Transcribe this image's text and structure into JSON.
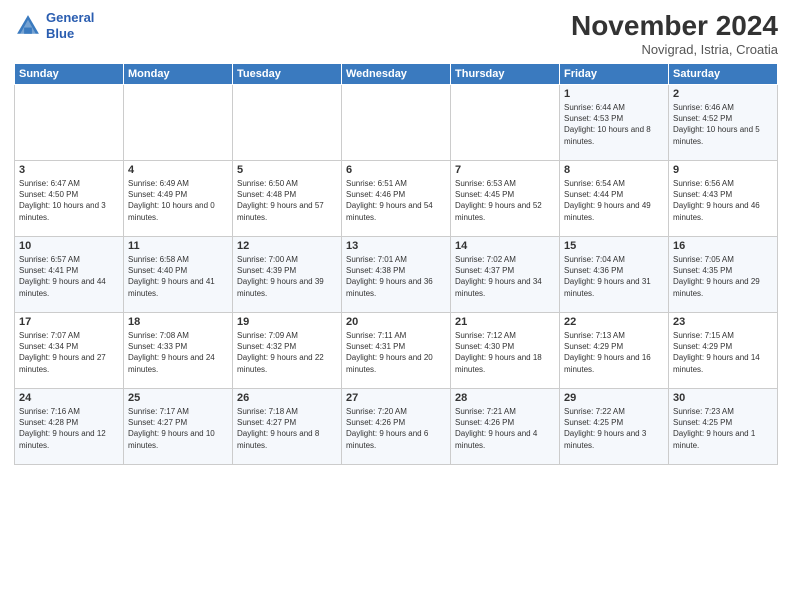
{
  "header": {
    "logo_line1": "General",
    "logo_line2": "Blue",
    "month": "November 2024",
    "location": "Novigrad, Istria, Croatia"
  },
  "weekdays": [
    "Sunday",
    "Monday",
    "Tuesday",
    "Wednesday",
    "Thursday",
    "Friday",
    "Saturday"
  ],
  "weeks": [
    [
      {
        "day": "",
        "info": ""
      },
      {
        "day": "",
        "info": ""
      },
      {
        "day": "",
        "info": ""
      },
      {
        "day": "",
        "info": ""
      },
      {
        "day": "",
        "info": ""
      },
      {
        "day": "1",
        "info": "Sunrise: 6:44 AM\nSunset: 4:53 PM\nDaylight: 10 hours and 8 minutes."
      },
      {
        "day": "2",
        "info": "Sunrise: 6:46 AM\nSunset: 4:52 PM\nDaylight: 10 hours and 5 minutes."
      }
    ],
    [
      {
        "day": "3",
        "info": "Sunrise: 6:47 AM\nSunset: 4:50 PM\nDaylight: 10 hours and 3 minutes."
      },
      {
        "day": "4",
        "info": "Sunrise: 6:49 AM\nSunset: 4:49 PM\nDaylight: 10 hours and 0 minutes."
      },
      {
        "day": "5",
        "info": "Sunrise: 6:50 AM\nSunset: 4:48 PM\nDaylight: 9 hours and 57 minutes."
      },
      {
        "day": "6",
        "info": "Sunrise: 6:51 AM\nSunset: 4:46 PM\nDaylight: 9 hours and 54 minutes."
      },
      {
        "day": "7",
        "info": "Sunrise: 6:53 AM\nSunset: 4:45 PM\nDaylight: 9 hours and 52 minutes."
      },
      {
        "day": "8",
        "info": "Sunrise: 6:54 AM\nSunset: 4:44 PM\nDaylight: 9 hours and 49 minutes."
      },
      {
        "day": "9",
        "info": "Sunrise: 6:56 AM\nSunset: 4:43 PM\nDaylight: 9 hours and 46 minutes."
      }
    ],
    [
      {
        "day": "10",
        "info": "Sunrise: 6:57 AM\nSunset: 4:41 PM\nDaylight: 9 hours and 44 minutes."
      },
      {
        "day": "11",
        "info": "Sunrise: 6:58 AM\nSunset: 4:40 PM\nDaylight: 9 hours and 41 minutes."
      },
      {
        "day": "12",
        "info": "Sunrise: 7:00 AM\nSunset: 4:39 PM\nDaylight: 9 hours and 39 minutes."
      },
      {
        "day": "13",
        "info": "Sunrise: 7:01 AM\nSunset: 4:38 PM\nDaylight: 9 hours and 36 minutes."
      },
      {
        "day": "14",
        "info": "Sunrise: 7:02 AM\nSunset: 4:37 PM\nDaylight: 9 hours and 34 minutes."
      },
      {
        "day": "15",
        "info": "Sunrise: 7:04 AM\nSunset: 4:36 PM\nDaylight: 9 hours and 31 minutes."
      },
      {
        "day": "16",
        "info": "Sunrise: 7:05 AM\nSunset: 4:35 PM\nDaylight: 9 hours and 29 minutes."
      }
    ],
    [
      {
        "day": "17",
        "info": "Sunrise: 7:07 AM\nSunset: 4:34 PM\nDaylight: 9 hours and 27 minutes."
      },
      {
        "day": "18",
        "info": "Sunrise: 7:08 AM\nSunset: 4:33 PM\nDaylight: 9 hours and 24 minutes."
      },
      {
        "day": "19",
        "info": "Sunrise: 7:09 AM\nSunset: 4:32 PM\nDaylight: 9 hours and 22 minutes."
      },
      {
        "day": "20",
        "info": "Sunrise: 7:11 AM\nSunset: 4:31 PM\nDaylight: 9 hours and 20 minutes."
      },
      {
        "day": "21",
        "info": "Sunrise: 7:12 AM\nSunset: 4:30 PM\nDaylight: 9 hours and 18 minutes."
      },
      {
        "day": "22",
        "info": "Sunrise: 7:13 AM\nSunset: 4:29 PM\nDaylight: 9 hours and 16 minutes."
      },
      {
        "day": "23",
        "info": "Sunrise: 7:15 AM\nSunset: 4:29 PM\nDaylight: 9 hours and 14 minutes."
      }
    ],
    [
      {
        "day": "24",
        "info": "Sunrise: 7:16 AM\nSunset: 4:28 PM\nDaylight: 9 hours and 12 minutes."
      },
      {
        "day": "25",
        "info": "Sunrise: 7:17 AM\nSunset: 4:27 PM\nDaylight: 9 hours and 10 minutes."
      },
      {
        "day": "26",
        "info": "Sunrise: 7:18 AM\nSunset: 4:27 PM\nDaylight: 9 hours and 8 minutes."
      },
      {
        "day": "27",
        "info": "Sunrise: 7:20 AM\nSunset: 4:26 PM\nDaylight: 9 hours and 6 minutes."
      },
      {
        "day": "28",
        "info": "Sunrise: 7:21 AM\nSunset: 4:26 PM\nDaylight: 9 hours and 4 minutes."
      },
      {
        "day": "29",
        "info": "Sunrise: 7:22 AM\nSunset: 4:25 PM\nDaylight: 9 hours and 3 minutes."
      },
      {
        "day": "30",
        "info": "Sunrise: 7:23 AM\nSunset: 4:25 PM\nDaylight: 9 hours and 1 minute."
      }
    ]
  ]
}
